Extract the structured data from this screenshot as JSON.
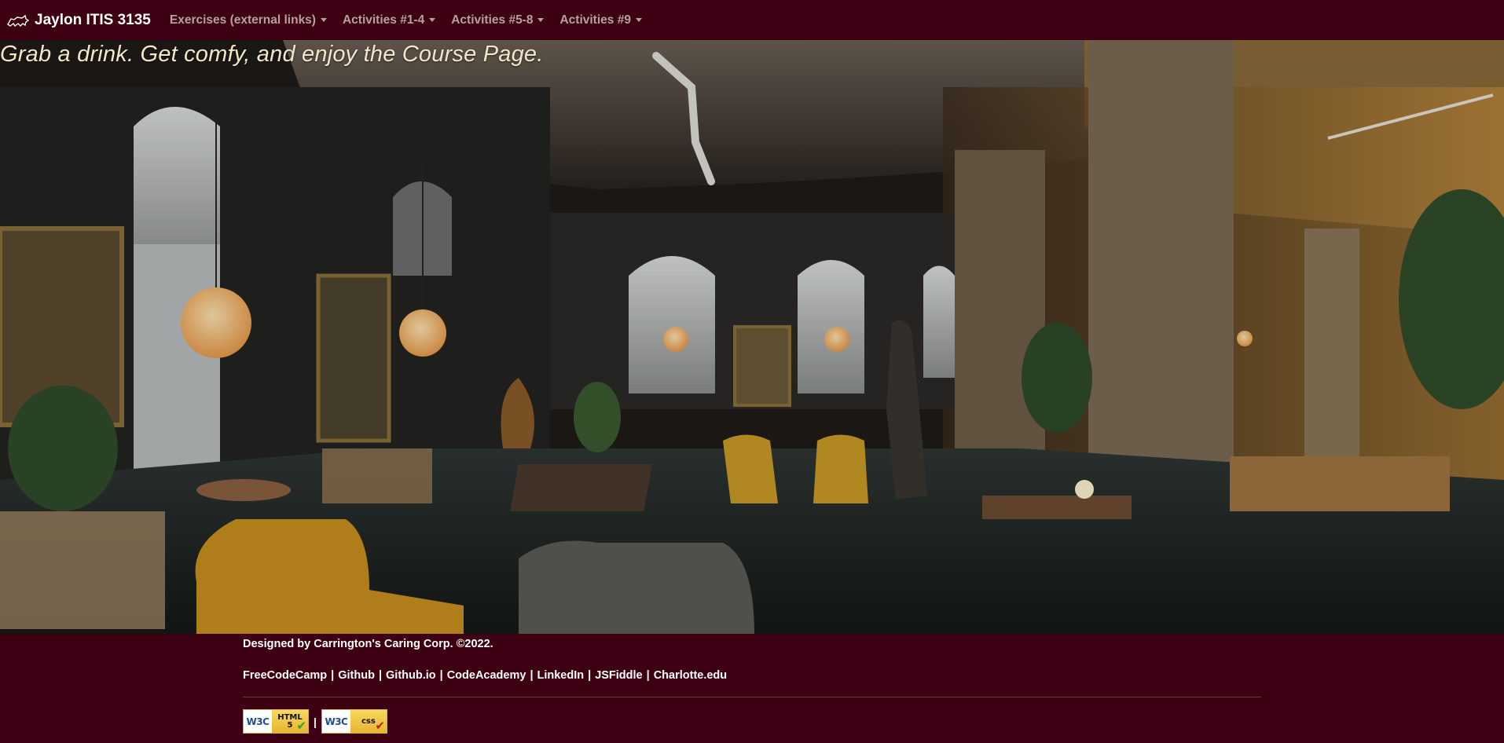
{
  "navbar": {
    "brand": "Jaylon ITIS 3135",
    "brand_icon": "cat-icon",
    "items": [
      {
        "label": "Exercises (external links)"
      },
      {
        "label": "Activities #1-4"
      },
      {
        "label": "Activities #5-8"
      },
      {
        "label": "Activities #9"
      }
    ]
  },
  "hero": {
    "tagline": "Grab a drink. Get comfy, and enjoy the Course Page."
  },
  "footer": {
    "credit": "Designed by Carrington's Caring Corp. ©2022.",
    "links": [
      {
        "label": "FreeCodeCamp"
      },
      {
        "label": "Github"
      },
      {
        "label": "Github.io"
      },
      {
        "label": "CodeAcademy"
      },
      {
        "label": "LinkedIn"
      },
      {
        "label": "JSFiddle"
      },
      {
        "label": "Charlotte.edu"
      }
    ],
    "link_separator": "|",
    "badges": [
      {
        "left": "W3C",
        "line1": "HTML",
        "line2": "5",
        "check": "✔"
      },
      {
        "left": "W3C",
        "line1": "css",
        "line2": "",
        "check": "✔"
      }
    ],
    "badge_separator": "|"
  },
  "colors": {
    "background": "#3d0013",
    "nav_text": "#ffffff",
    "tagline": "#f2e6c8"
  }
}
